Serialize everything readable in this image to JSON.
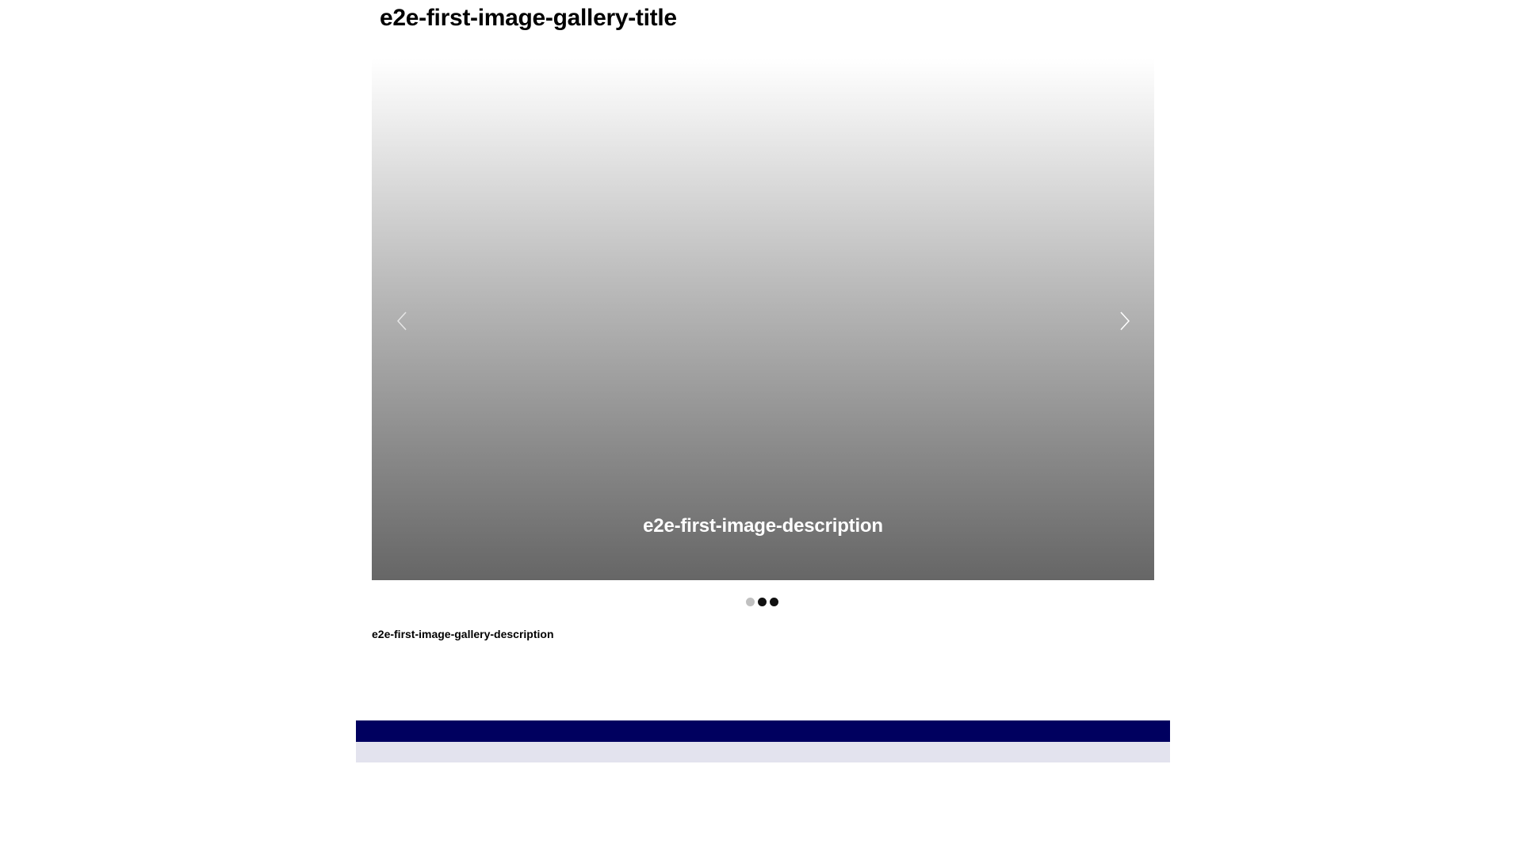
{
  "gallery": {
    "title": "e2e-first-image-gallery-title",
    "description": "e2e-first-image-gallery-description",
    "slides": [
      {
        "caption": "e2e-first-image-description",
        "active": true
      },
      {
        "caption": "",
        "active": false
      },
      {
        "caption": "",
        "active": false
      }
    ],
    "current_caption": "e2e-first-image-description",
    "controls": {
      "prev_icon": "chevron-left-icon",
      "next_icon": "chevron-right-icon"
    }
  },
  "colors": {
    "footer_primary": "#00005f",
    "footer_secondary": "#e3e3ee",
    "dot_active": "#111111",
    "dot_inactive": "#c0c0c0"
  }
}
